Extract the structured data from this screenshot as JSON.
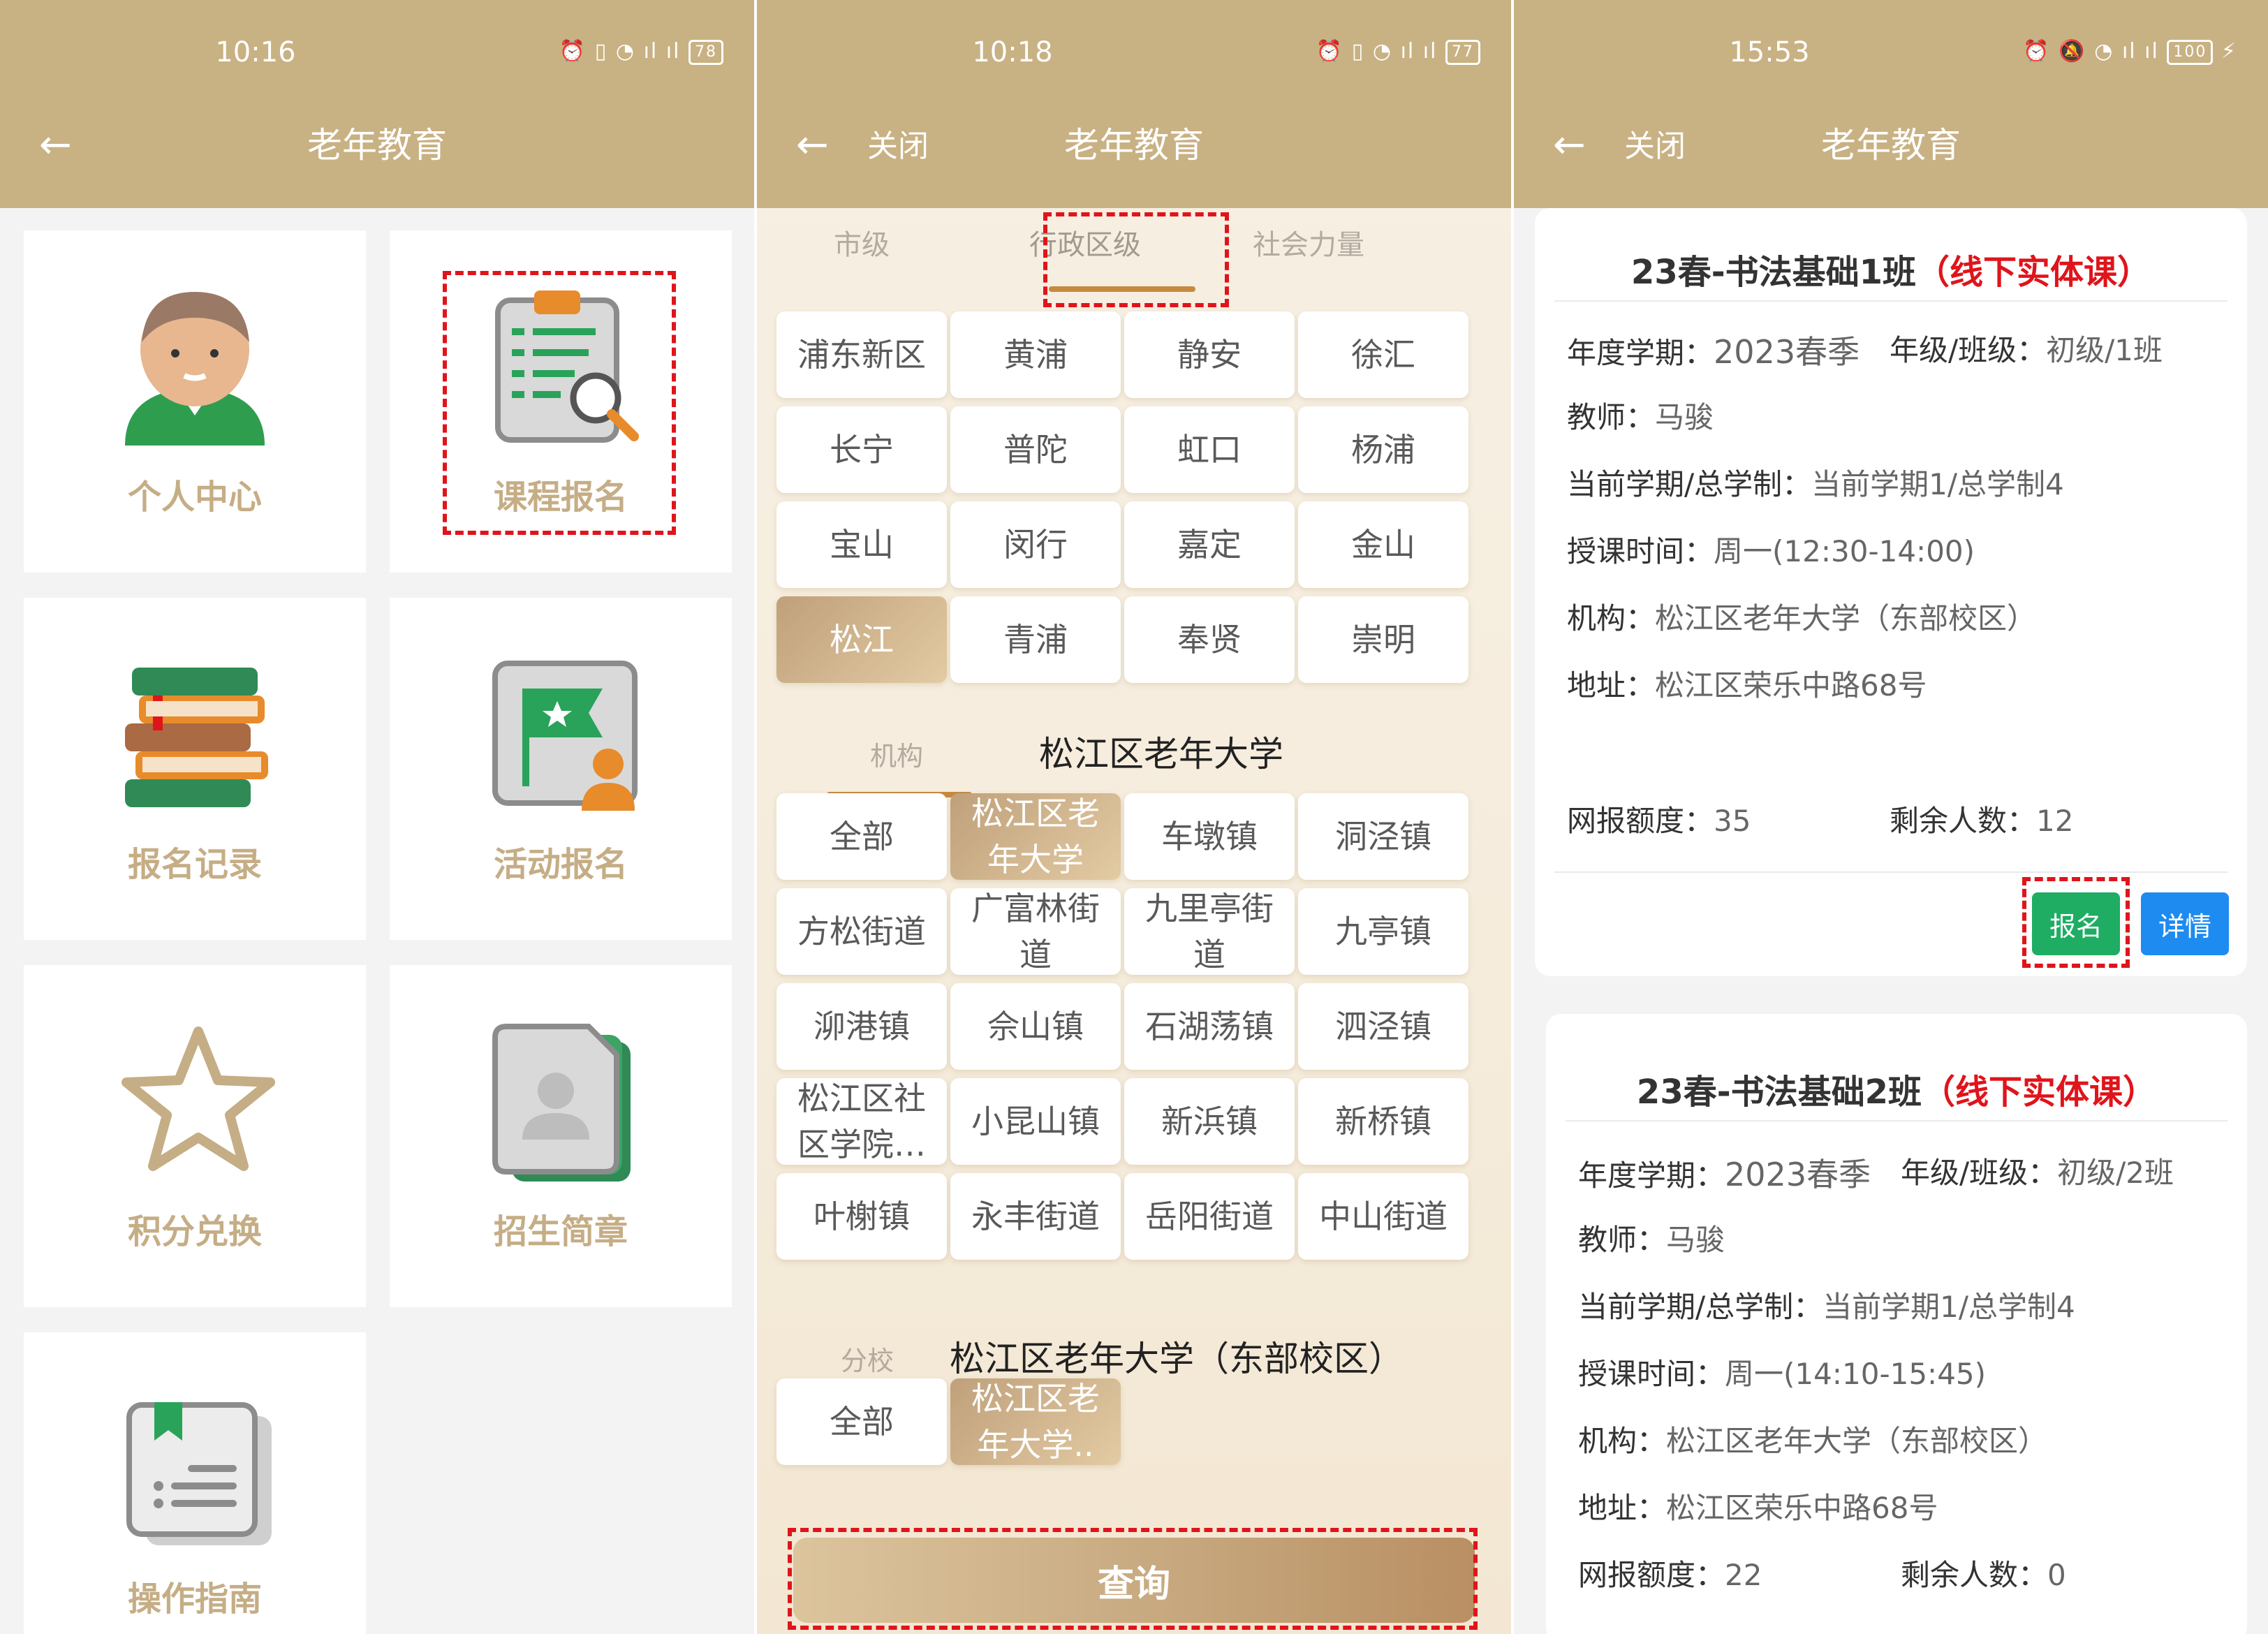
{
  "colors": {
    "header": "#c8b183",
    "accent_gold": "#c68a3e",
    "tile_label": "#c5ad85",
    "highlight_red": "#e0141b",
    "signup_green": "#1ead63",
    "detail_blue": "#1e8bf0"
  },
  "screen1": {
    "status_time": "10:16",
    "battery": "78",
    "back_icon": "arrow-left-icon",
    "title": "老年教育",
    "tiles": [
      {
        "label": "个人中心",
        "icon": "person-icon"
      },
      {
        "label": "课程报名",
        "icon": "clipboard-search-icon"
      },
      {
        "label": "报名记录",
        "icon": "books-icon"
      },
      {
        "label": "活动报名",
        "icon": "flag-person-icon"
      },
      {
        "label": "积分兑换",
        "icon": "star-icon"
      },
      {
        "label": "招生简章",
        "icon": "profile-doc-icon"
      },
      {
        "label": "操作指南",
        "icon": "guide-book-icon"
      }
    ]
  },
  "screen2": {
    "status_time": "10:18",
    "battery": "77",
    "close_label": "关闭",
    "title": "老年教育",
    "tabs": [
      "市级",
      "行政区级",
      "社会力量"
    ],
    "active_tab": "行政区级",
    "districts": [
      "浦东新区",
      "黄浦",
      "静安",
      "徐汇",
      "长宁",
      "普陀",
      "虹口",
      "杨浦",
      "宝山",
      "闵行",
      "嘉定",
      "金山",
      "松江",
      "青浦",
      "奉贤",
      "崇明"
    ],
    "selected_district": "松江",
    "org_label": "机构",
    "org_value": "松江区老年大学",
    "orgs": [
      "全部",
      "松江区老年大学",
      "车墩镇",
      "洞泾镇",
      "方松街道",
      "广富林街道",
      "九里亭街道",
      "九亭镇",
      "泖港镇",
      "佘山镇",
      "石湖荡镇",
      "泗泾镇",
      "松江区社区学院…",
      "小昆山镇",
      "新浜镇",
      "新桥镇",
      "叶榭镇",
      "永丰街道",
      "岳阳街道",
      "中山街道"
    ],
    "org_display": [
      "全部",
      "松江区老\n年大学",
      "车墩镇",
      "洞泾镇",
      "方松街道",
      "广富林街\n道",
      "九里亭街\n道",
      "九亭镇",
      "泖港镇",
      "佘山镇",
      "石湖荡镇",
      "泗泾镇",
      "松江区社\n区学院…",
      "小昆山镇",
      "新浜镇",
      "新桥镇",
      "叶榭镇",
      "永丰街道",
      "岳阳街道",
      "中山街道"
    ],
    "selected_org": "松江区老年大学",
    "branch_label": "分校",
    "branch_value": "松江区老年大学（东部校区）",
    "branches": [
      "全部",
      "松江区老\n年大学.."
    ],
    "selected_branch": "松江区老\n年大学..",
    "query_label": "查询"
  },
  "screen3": {
    "status_time": "15:53",
    "battery": "100",
    "close_label": "关闭",
    "title": "老年教育",
    "courses": [
      {
        "name": "23春-书法基础1班",
        "type": "（线下实体课）",
        "term_label": "年度学期：",
        "term": "2023春季",
        "grade_label": "年级/班级：",
        "grade": "初级/1班",
        "teacher_label": "教师：",
        "teacher": "马骏",
        "period_label": "当前学期/总学制：",
        "period": "当前学期1/总学制4",
        "time_label": "授课时间：",
        "time": "周一(12:30-14:00)",
        "org_label": "机构：",
        "org": "松江区老年大学（东部校区）",
        "addr_label": "地址：",
        "addr": "松江区荣乐中路68号",
        "quota_label": "网报额度：",
        "quota": "35",
        "remain_label": "剩余人数：",
        "remain": "12",
        "signup_label": "报名",
        "detail_label": "详情"
      },
      {
        "name": "23春-书法基础2班",
        "type": "（线下实体课）",
        "term_label": "年度学期：",
        "term": "2023春季",
        "grade_label": "年级/班级：",
        "grade": "初级/2班",
        "teacher_label": "教师：",
        "teacher": "马骏",
        "period_label": "当前学期/总学制：",
        "period": "当前学期1/总学制4",
        "time_label": "授课时间：",
        "time": "周一(14:10-15:45)",
        "org_label": "机构：",
        "org": "松江区老年大学（东部校区）",
        "addr_label": "地址：",
        "addr": "松江区荣乐中路68号",
        "quota_label": "网报额度：",
        "quota": "22",
        "remain_label": "剩余人数：",
        "remain": "0"
      }
    ]
  }
}
